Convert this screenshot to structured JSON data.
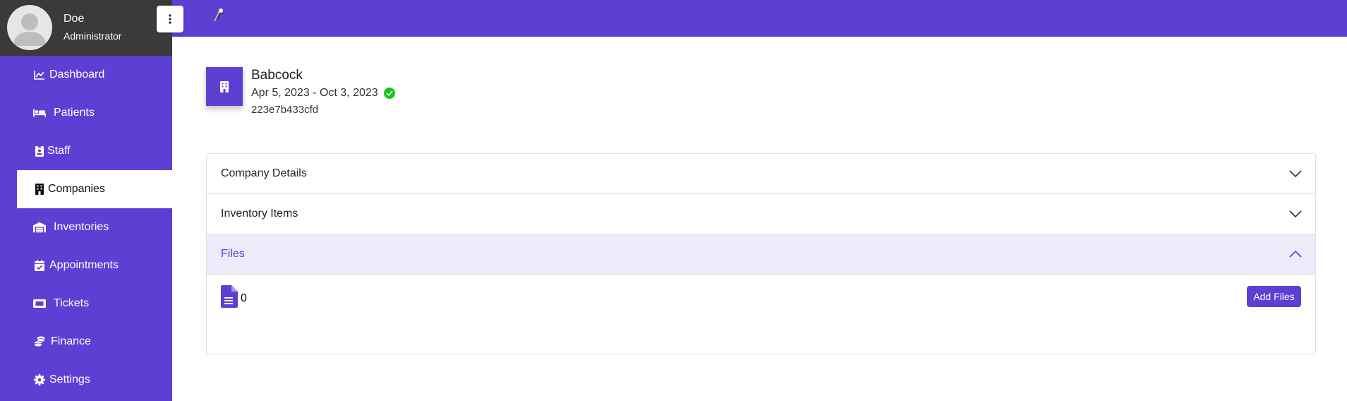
{
  "user": {
    "name": "Doe",
    "role": "Administrator"
  },
  "sidebar": {
    "items": [
      {
        "label": "Dashboard",
        "icon": "chart-line-icon"
      },
      {
        "label": "Patients",
        "icon": "bed-icon"
      },
      {
        "label": "Staff",
        "icon": "id-badge-icon"
      },
      {
        "label": "Companies",
        "icon": "building-icon",
        "active": true
      },
      {
        "label": "Inventories",
        "icon": "warehouse-icon"
      },
      {
        "label": "Appointments",
        "icon": "calendar-check-icon"
      },
      {
        "label": "Tickets",
        "icon": "ticket-icon"
      },
      {
        "label": "Finance",
        "icon": "coins-icon"
      },
      {
        "label": "Settings",
        "icon": "gear-icon"
      }
    ]
  },
  "company": {
    "name": "Babcock",
    "dates": "Apr 5, 2023 - Oct 3, 2023",
    "id": "223e7b433cfd",
    "status_icon": "check-circle-icon"
  },
  "accordion": {
    "sections": [
      {
        "title": "Company Details",
        "expanded": false
      },
      {
        "title": "Inventory Items",
        "expanded": false
      },
      {
        "title": "Files",
        "expanded": true
      }
    ],
    "files": {
      "count": "0",
      "add_label": "Add Files",
      "icon": "file-lines-icon"
    }
  },
  "colors": {
    "brand": "#5d3fd3",
    "user_panel": "#3a3a3a",
    "status_ok": "#14c914",
    "open_header_bg": "#edeaf9"
  }
}
